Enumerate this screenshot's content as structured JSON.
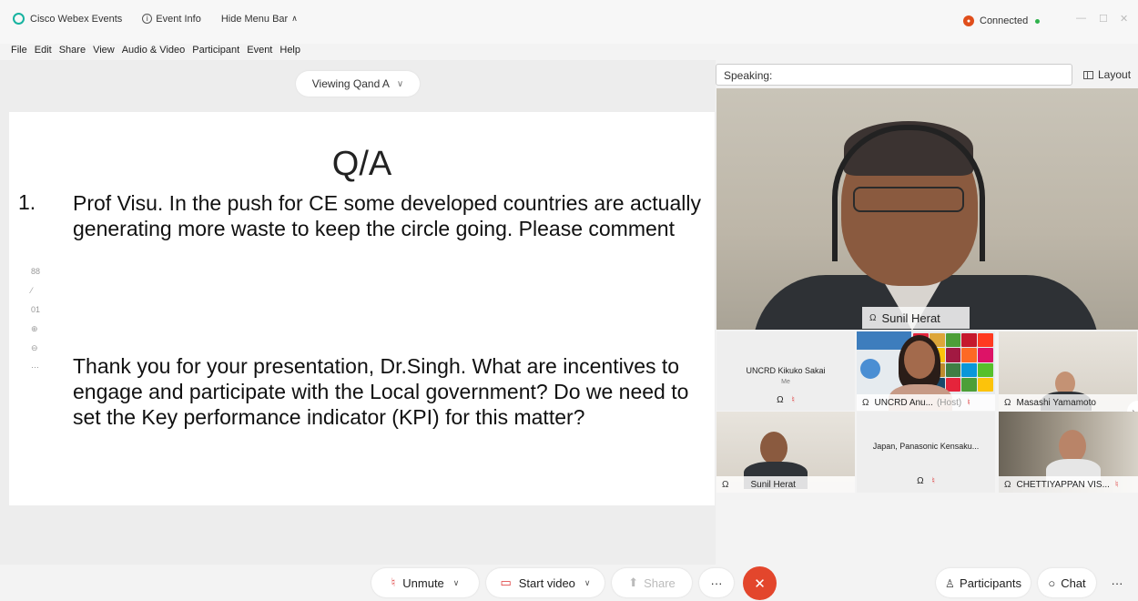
{
  "titlebar": {
    "app_name": "Cisco Webex Events",
    "event_info": "Event Info",
    "hide_menu": "Hide Menu Bar",
    "connection_status": "Connected"
  },
  "menu": [
    "File",
    "Edit",
    "Share",
    "View",
    "Audio & Video",
    "Participant",
    "Event",
    "Help"
  ],
  "stage": {
    "viewing_label": "Viewing Qand A",
    "slide_title": "Q/A",
    "q1_number": "1.",
    "q1_text": "Prof Visu. In the push for CE some developed countries are actually generating more waste to keep the circle going. Please comment",
    "q2_text": "Thank you for your presentation, Dr.Singh. What are incentives to engage and participate with the Local government? Do we need to set the Key performance indicator (KPI) for this matter?"
  },
  "panel": {
    "speaking_label": "Speaking:",
    "layout_label": "Layout",
    "active_speaker": "Sunil Herat",
    "tiles": [
      {
        "name": "UNCRD Kikuko Sakai",
        "sub": "Me"
      },
      {
        "name": "UNCRD Anu...",
        "tag": "(Host)"
      },
      {
        "name": "Masashi Yamamoto"
      },
      {
        "name": "Sunil Herat"
      },
      {
        "name": "Japan, Panasonic Kensaku..."
      },
      {
        "name": "CHETTIYAPPAN VIS..."
      }
    ]
  },
  "controls": {
    "unmute": "Unmute",
    "start_video": "Start video",
    "share": "Share",
    "more": "···",
    "end": "✕",
    "participants": "Participants",
    "chat": "Chat"
  },
  "colors": {
    "accent_red": "#e3462c",
    "connected_green": "#2fb24c",
    "webex_teal": "#17b3a0"
  }
}
